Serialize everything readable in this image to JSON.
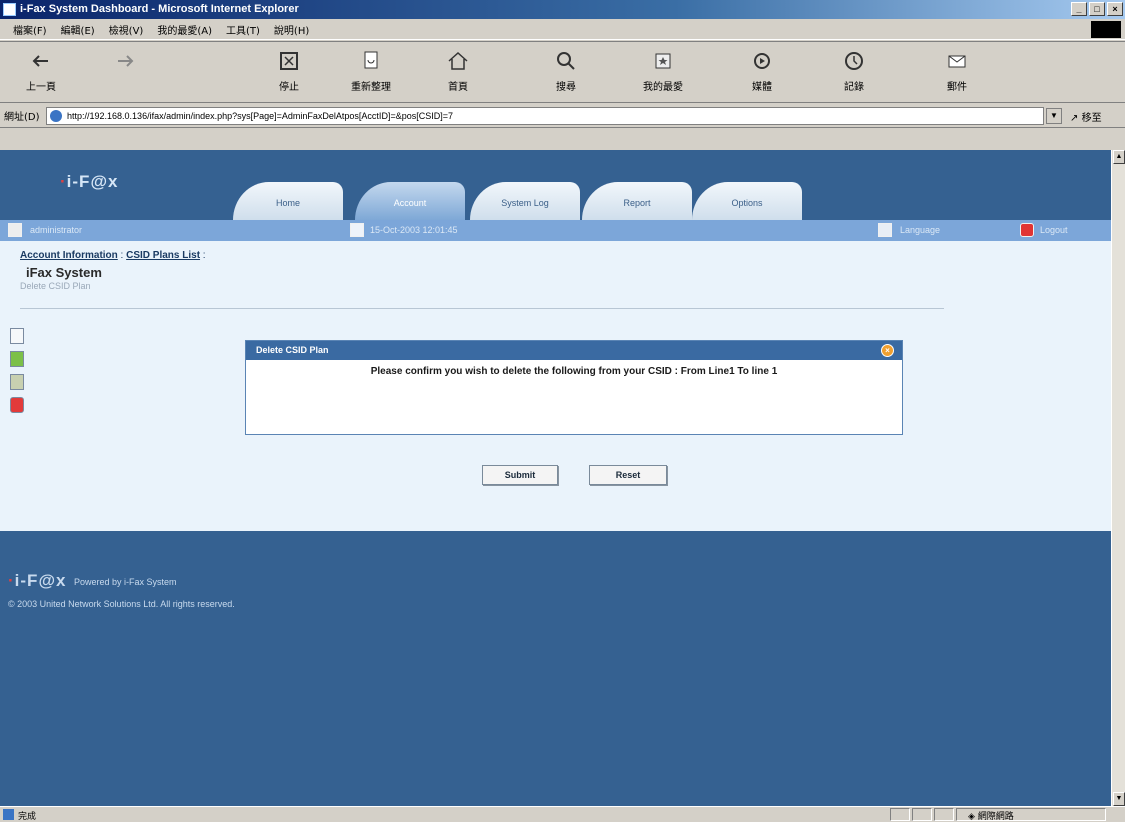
{
  "window": {
    "title": "i-Fax System Dashboard - Microsoft Internet Explorer",
    "controls": [
      "_",
      "□",
      "×"
    ]
  },
  "menubar": [
    "檔案(F)",
    "編輯(E)",
    "檢視(V)",
    "我的最愛(A)",
    "工具(T)",
    "說明(H)"
  ],
  "toolbar": [
    {
      "label": "上一頁",
      "icon": "back-icon"
    },
    {
      "label": "",
      "icon": "forward-icon"
    },
    {
      "label": "停止",
      "icon": "stop-icon"
    },
    {
      "label": "重新整理",
      "icon": "refresh-icon"
    },
    {
      "label": "首頁",
      "icon": "home-icon"
    },
    {
      "label": "搜尋",
      "icon": "search-icon"
    },
    {
      "label": "我的最愛",
      "icon": "favorites-icon"
    },
    {
      "label": "媒體",
      "icon": "media-icon"
    },
    {
      "label": "記錄",
      "icon": "history-icon"
    },
    {
      "label": "郵件",
      "icon": "mail-icon"
    }
  ],
  "address": {
    "label": "網址(D)",
    "url": "http://192.168.0.136/ifax/admin/index.php?sys[Page]=AdminFaxDelAtpos[AcctID]=&pos[CSID]=7",
    "go": "移至"
  },
  "app": {
    "brand": "i-F@x",
    "tabs": [
      "Home",
      "Account",
      "System Log",
      "Report",
      "Options"
    ],
    "active_tab": "Account",
    "user": "administrator",
    "datetime": "15-Oct-2003 12:01:45",
    "language": "Language",
    "logout": "Logout",
    "breadcrumb": {
      "link1": "Account Information",
      "sep": " : ",
      "link2": "CSID Plans List",
      "tail": " :"
    },
    "title": "iFax System",
    "subtitle": "Delete CSID Plan",
    "dialog": {
      "title": "Delete CSID Plan",
      "message": "Please confirm you wish to delete the following from your CSID : From Line1 To line 1"
    },
    "buttons": {
      "submit": "Submit",
      "reset": "Reset"
    },
    "footer": {
      "powered": "Powered by i-Fax System",
      "copyright": "© 2003 United Network Solutions Ltd. All rights reserved."
    }
  },
  "status": {
    "left": "完成",
    "zone": "網際網路"
  },
  "colors": {
    "header": "#356191",
    "userbar": "#7ca6d9",
    "page_bg": "#eaf3fb",
    "dialog_head": "#3a6aa2"
  }
}
